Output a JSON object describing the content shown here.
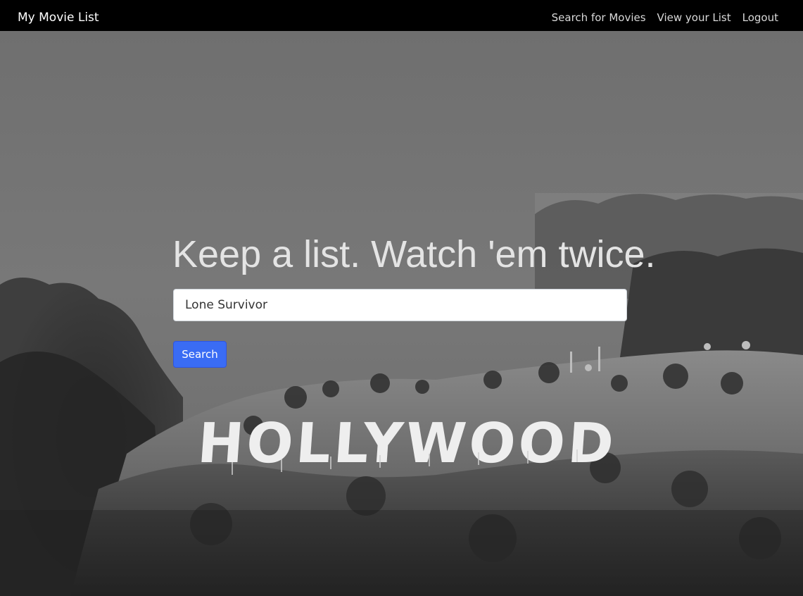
{
  "navbar": {
    "brand": "My Movie List",
    "links": [
      "Search for Movies",
      "View your List",
      "Logout"
    ]
  },
  "hero": {
    "headline": "Keep a list. Watch 'em twice.",
    "background_sign_text": "HOLLYWOOD"
  },
  "search": {
    "value": "Lone Survivor",
    "button_label": "Search"
  },
  "colors": {
    "navbar_bg": "#000000",
    "button_bg": "#3a6cf4",
    "headline": "#e4e4e4"
  }
}
